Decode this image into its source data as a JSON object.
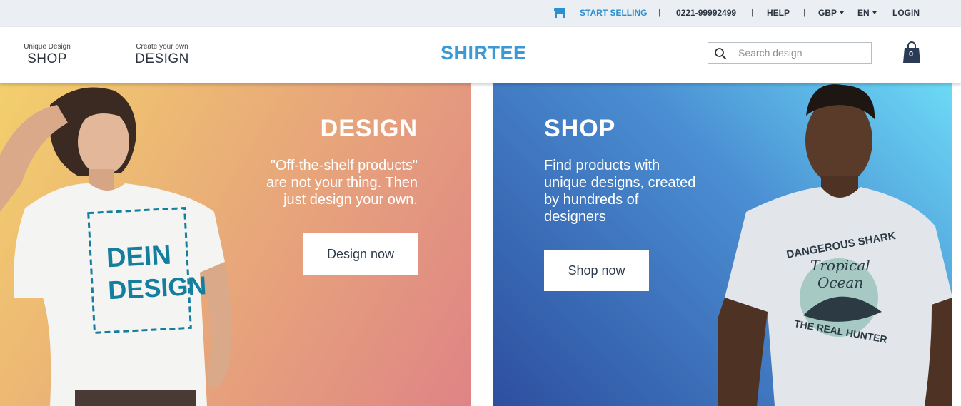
{
  "topbar": {
    "start_selling": "START SELLING",
    "phone": "0221-99992499",
    "help": "HELP",
    "currency": "GBP",
    "language": "EN",
    "login": "LOGIN",
    "separator": "|"
  },
  "header": {
    "nav": [
      {
        "small": "Unique Design",
        "big": "SHOP"
      },
      {
        "small": "Create your own",
        "big": "DESIGN"
      }
    ],
    "logo_text": "SHIRTEE",
    "search_placeholder": "Search design",
    "cart_count": "0"
  },
  "hero": {
    "design": {
      "title": "DESIGN",
      "text_lines": [
        "\"Off-the-shelf products\"",
        "are not your thing. Then",
        "just design your own."
      ],
      "button": "Design now",
      "shirt_print": [
        "DEIN",
        "DESIGN"
      ]
    },
    "shop": {
      "title": "SHOP",
      "text_lines": [
        "Find products with",
        "unique designs, created",
        "by hundreds of",
        "designers"
      ],
      "button": "Shop now",
      "shirt_print": [
        "DANGEROUS SHARK",
        "Tropical",
        "Ocean",
        "THE REAL HUNTER"
      ]
    }
  },
  "colors": {
    "accent": "#2b8fd0",
    "logo": "#3b9ad6",
    "cart": "#2b3a55"
  }
}
